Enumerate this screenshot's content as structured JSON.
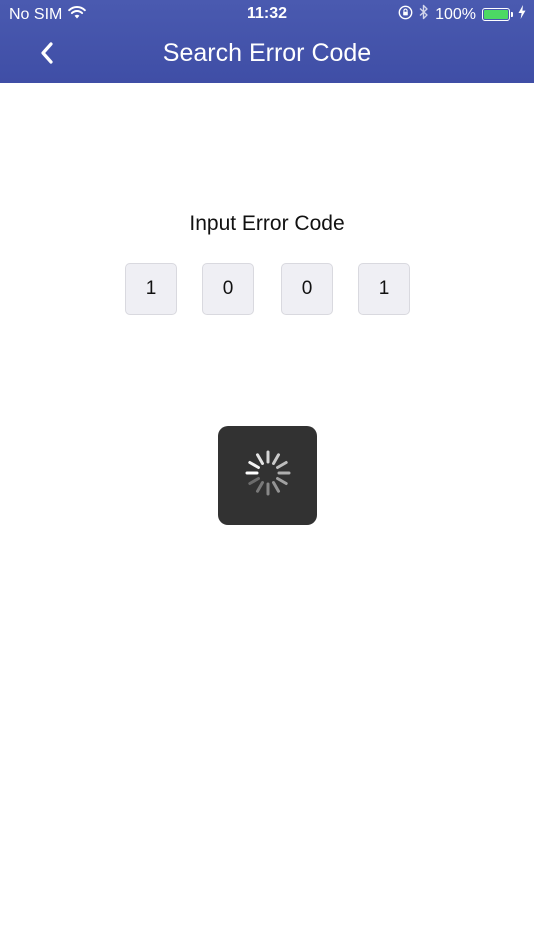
{
  "status_bar": {
    "carrier": "No SIM",
    "time": "11:32",
    "battery_percent": "100%",
    "battery_level": 1.0,
    "battery_color": "#4cd964",
    "icons": [
      "wifi-icon",
      "orientation-lock-icon",
      "bluetooth-icon",
      "battery-icon",
      "charging-bolt-icon"
    ]
  },
  "navbar": {
    "title": "Search Error Code",
    "back_icon": "chevron-left-icon",
    "background": "#4151a8"
  },
  "main": {
    "prompt": "Input Error Code",
    "code_digits": [
      "1",
      "0",
      "0",
      "1"
    ]
  },
  "loading": {
    "icon": "activity-spinner-icon",
    "visible": true
  }
}
